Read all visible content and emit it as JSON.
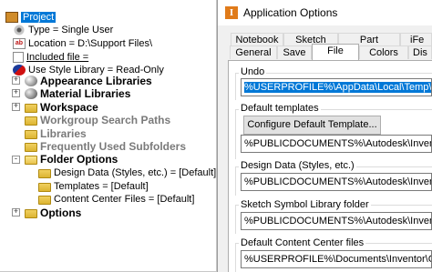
{
  "project_tree": {
    "root_label": "Project",
    "items": [
      {
        "label": "Type = Single User",
        "icon": "gear-icon"
      },
      {
        "label": "Location = D:\\Support Files\\",
        "icon": "location-ab-icon"
      },
      {
        "label": "Included file =",
        "icon": "document-icon"
      },
      {
        "label": "Use Style Library = Read-Only",
        "icon": "style-library-icon"
      },
      {
        "label": "Appearance Libraries",
        "icon": "appearance-sphere-icon",
        "expander": "+"
      },
      {
        "label": "Material Libraries",
        "icon": "material-sphere-icon",
        "expander": "+"
      },
      {
        "label": "Workspace",
        "icon": "folder-icon",
        "expander": "+"
      },
      {
        "label": "Workgroup Search Paths",
        "icon": "folder-icon"
      },
      {
        "label": "Libraries",
        "icon": "folder-icon"
      },
      {
        "label": "Frequently Used Subfolders",
        "icon": "folder-icon"
      },
      {
        "label": "Folder Options",
        "icon": "folder-open-icon",
        "expander": "-"
      },
      {
        "label": "Design Data (Styles, etc.) = [Default]",
        "icon": "folder-icon"
      },
      {
        "label": "Templates = [Default]",
        "icon": "folder-icon"
      },
      {
        "label": "Content Center Files = [Default]",
        "icon": "folder-icon"
      },
      {
        "label": "Options",
        "icon": "folder-icon",
        "expander": "+"
      }
    ]
  },
  "dialog": {
    "title": "Application Options",
    "app_icon_letter": "I",
    "tabs_back": [
      "Notebook",
      "Sketch",
      "Part",
      "iFe"
    ],
    "tabs_front": [
      "General",
      "Save",
      "File",
      "Colors",
      "Dis"
    ],
    "active_tab": "File",
    "groups": {
      "undo": {
        "label": "Undo",
        "value": "%USERPROFILE%\\AppData\\Local\\Temp\\"
      },
      "default_templates": {
        "label": "Default templates",
        "button": "Configure Default Template...",
        "value": "%PUBLICDOCUMENTS%\\Autodesk\\Inventor %REL"
      },
      "design_data": {
        "label": "Design Data (Styles, etc.)",
        "value": "%PUBLICDOCUMENTS%\\Autodesk\\Inventor %REL"
      },
      "sketch_symbol": {
        "label": "Sketch Symbol Library folder",
        "value": "%PUBLICDOCUMENTS%\\Autodesk\\Inventor %REL"
      },
      "content_center": {
        "label": "Default Content Center files",
        "value": "%USERPROFILE%\\Documents\\Inventor\\Content C"
      }
    }
  }
}
